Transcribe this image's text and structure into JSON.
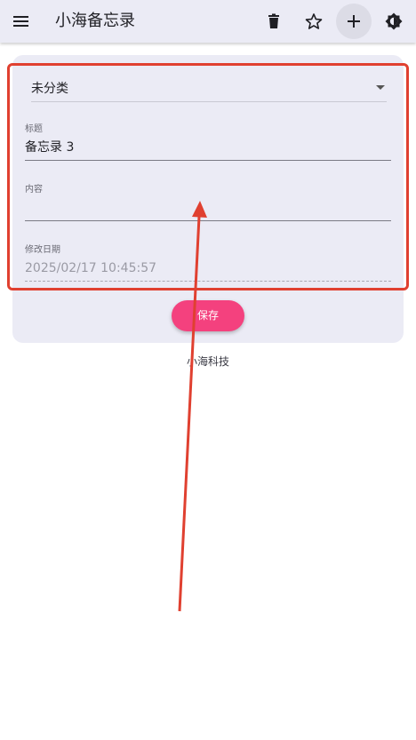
{
  "appbar": {
    "title": "小海备忘录",
    "icons": [
      "menu-icon",
      "delete-icon",
      "star-outline-icon",
      "add-icon",
      "brightness-icon"
    ]
  },
  "form": {
    "category": "未分类",
    "title_label": "标题",
    "title_value": "备忘录 3",
    "content_label": "内容",
    "content_value": "",
    "date_label": "修改日期",
    "date_value": "2025/02/17 10:45:57",
    "save_label": "保存"
  },
  "footer": {
    "text": "小海科技"
  },
  "colors": {
    "accent": "#f4417e",
    "annotation": "#e04030",
    "surface": "#ebebf5"
  }
}
